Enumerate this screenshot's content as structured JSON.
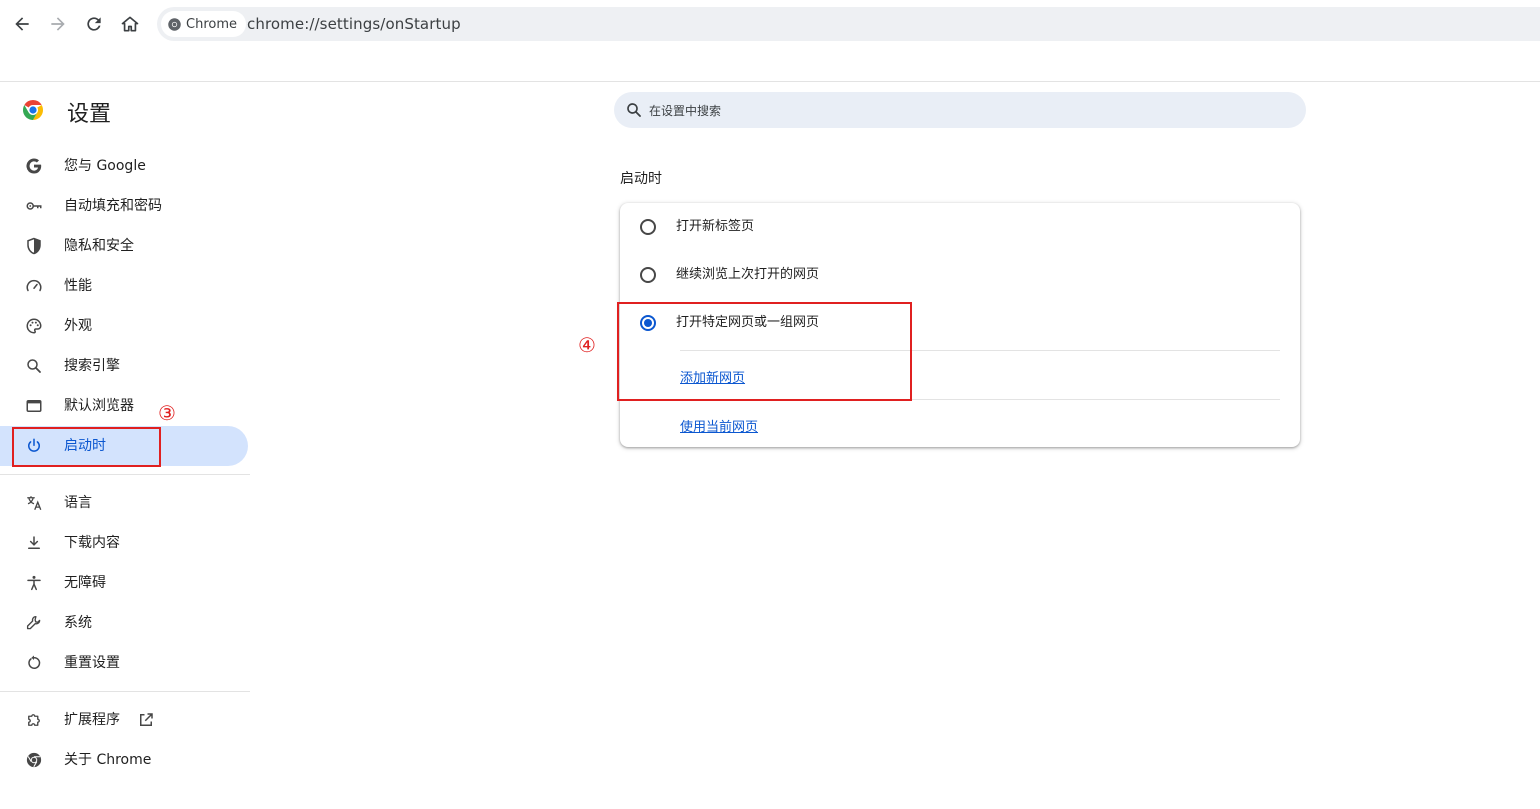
{
  "browser": {
    "chip_label": "Chrome",
    "url": "chrome://settings/onStartup"
  },
  "header": {
    "title": "设置",
    "search_placeholder": "在设置中搜索"
  },
  "sidebar": {
    "items": [
      {
        "label": "您与 Google",
        "icon": "google-g-icon"
      },
      {
        "label": "自动填充和密码",
        "icon": "key-icon"
      },
      {
        "label": "隐私和安全",
        "icon": "shield-icon"
      },
      {
        "label": "性能",
        "icon": "speedometer-icon"
      },
      {
        "label": "外观",
        "icon": "palette-icon"
      },
      {
        "label": "搜索引擎",
        "icon": "search-icon"
      },
      {
        "label": "默认浏览器",
        "icon": "browser-window-icon"
      },
      {
        "label": "启动时",
        "icon": "power-icon",
        "active": true
      },
      {
        "label": "语言",
        "icon": "translate-icon"
      },
      {
        "label": "下载内容",
        "icon": "download-icon"
      },
      {
        "label": "无障碍",
        "icon": "accessibility-icon"
      },
      {
        "label": "系统",
        "icon": "wrench-icon"
      },
      {
        "label": "重置设置",
        "icon": "reset-icon"
      },
      {
        "label": "扩展程序",
        "icon": "puzzle-icon"
      },
      {
        "label": "关于 Chrome",
        "icon": "chrome-logo-icon"
      }
    ]
  },
  "startup": {
    "section_title": "启动时",
    "options": [
      {
        "label": "打开新标签页",
        "checked": false
      },
      {
        "label": "继续浏览上次打开的网页",
        "checked": false
      },
      {
        "label": "打开特定网页或一组网页",
        "checked": true
      }
    ],
    "add_page_link": "添加新网页",
    "use_current_link": "使用当前网页"
  },
  "annotations": {
    "step3": "③",
    "step4": "④"
  },
  "colors": {
    "accent": "#0b57d0",
    "active_bg": "#d3e3fd",
    "annotation": "#e02020"
  }
}
